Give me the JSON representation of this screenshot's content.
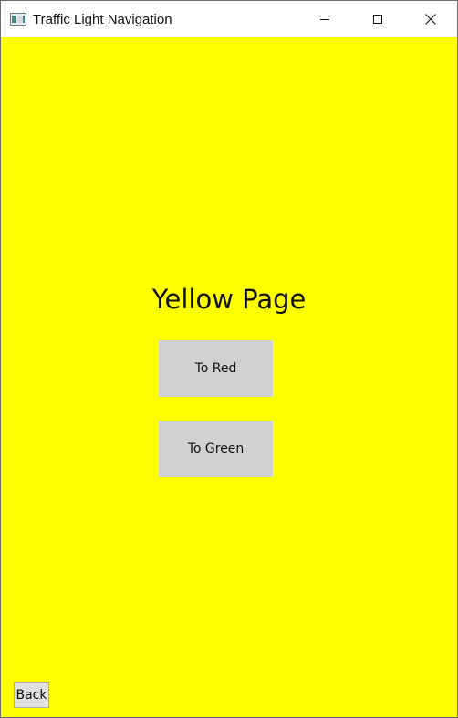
{
  "window": {
    "title": "Traffic Light Navigation",
    "icon": "app-window-icon",
    "caption_buttons": [
      "minimize-icon",
      "maximize-icon",
      "close-icon"
    ]
  },
  "page": {
    "background_color": "#ffff00",
    "title": "Yellow Page",
    "buttons": {
      "to_red": "To Red",
      "to_green": "To Green",
      "back": "Back"
    }
  }
}
